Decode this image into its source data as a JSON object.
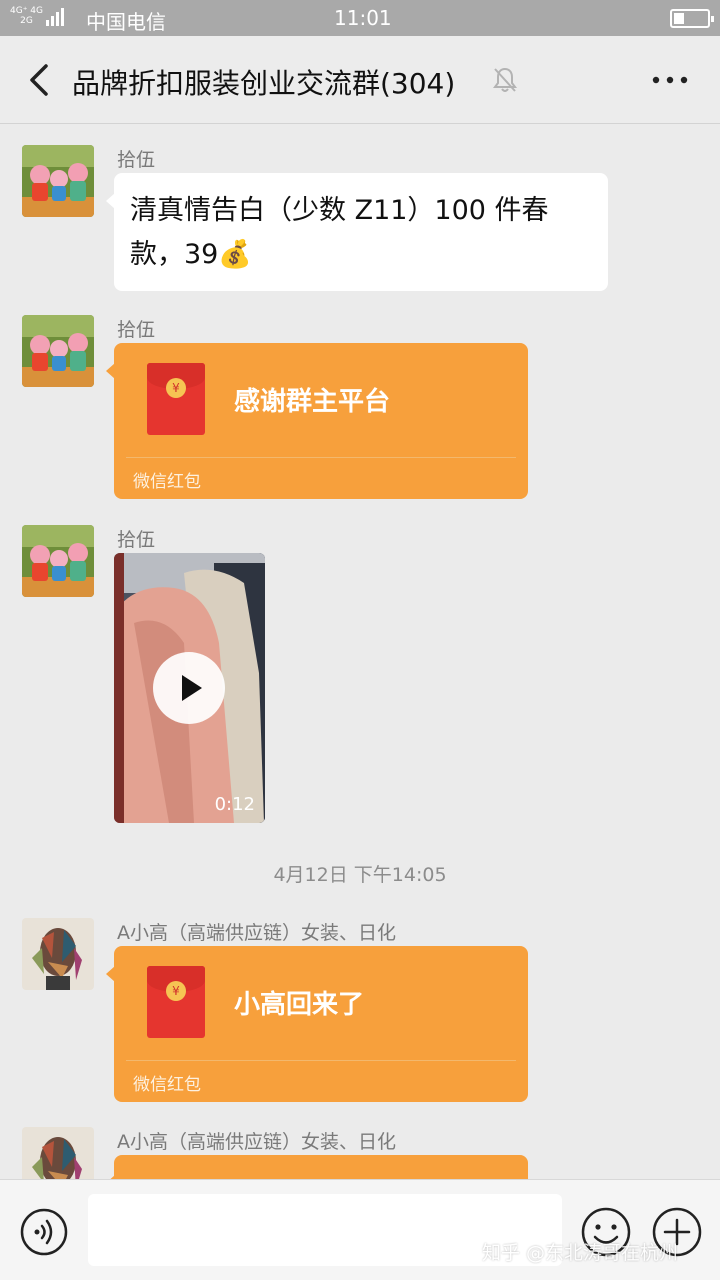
{
  "status_bar": {
    "network_top": "4G⁺ 4G",
    "network_bottom": "2G",
    "carrier": "中国电信",
    "time": "11:01"
  },
  "header": {
    "title": "品牌折扣服装创业交流群(304)",
    "back_icon": "back-arrow-icon",
    "mute_icon": "bell-muted-icon",
    "more_icon": "more-dots-icon"
  },
  "messages": [
    {
      "type": "text",
      "sender": "拾伍",
      "text": "清真情告白（少数 Z11）100 件春款，39💰"
    },
    {
      "type": "red_packet",
      "sender": "拾伍",
      "title": "感谢群主平台",
      "footer": "微信红包"
    },
    {
      "type": "video",
      "sender": "拾伍",
      "duration": "0:12"
    },
    {
      "type": "red_packet",
      "sender": "A小高（高端供应链）女装、日化",
      "title": "小高回来了",
      "footer": "微信红包"
    },
    {
      "type": "red_packet",
      "sender": "A小高（高端供应链）女装、日化",
      "title": "",
      "footer": ""
    }
  ],
  "timestamp": "4月12日 下午14:05",
  "input_bar": {
    "placeholder": "",
    "voice_icon": "voice-icon",
    "emoji_icon": "emoji-icon",
    "plus_icon": "plus-icon"
  },
  "watermark": "知乎 @东北涛哥在杭州",
  "colors": {
    "background": "#ebebeb",
    "red_packet": "#f7a03c",
    "envelope": "#e5352f",
    "status_bar": "#a9a9a9"
  }
}
